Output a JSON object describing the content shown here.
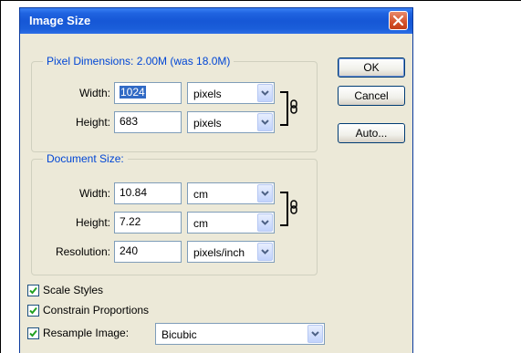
{
  "window": {
    "title": "Image Size"
  },
  "pixel_dimensions": {
    "legend": "Pixel Dimensions:  2.00M (was 18.0M)",
    "width_label": "Width:",
    "width_value": "1024",
    "width_unit": "pixels",
    "height_label": "Height:",
    "height_value": "683",
    "height_unit": "pixels"
  },
  "document_size": {
    "legend": "Document Size:",
    "width_label": "Width:",
    "width_value": "10.84",
    "width_unit": "cm",
    "height_label": "Height:",
    "height_value": "7.22",
    "height_unit": "cm",
    "resolution_label": "Resolution:",
    "resolution_value": "240",
    "resolution_unit": "pixels/inch"
  },
  "buttons": {
    "ok": "OK",
    "cancel": "Cancel",
    "auto": "Auto..."
  },
  "options": {
    "scale_styles": {
      "label": "Scale Styles",
      "checked": true
    },
    "constrain_proportions": {
      "label": "Constrain Proportions",
      "checked": true
    },
    "resample_image": {
      "label": "Resample Image:",
      "checked": true,
      "method": "Bicubic"
    }
  },
  "icons": [
    "close-icon",
    "chain-link-icon",
    "chevron-down-icon",
    "checkmark-icon"
  ],
  "colors": {
    "titlebar": "#1657d6",
    "dialog_bg": "#ece9d8",
    "legend_text": "#0046d5",
    "close_button": "#d5522a"
  }
}
